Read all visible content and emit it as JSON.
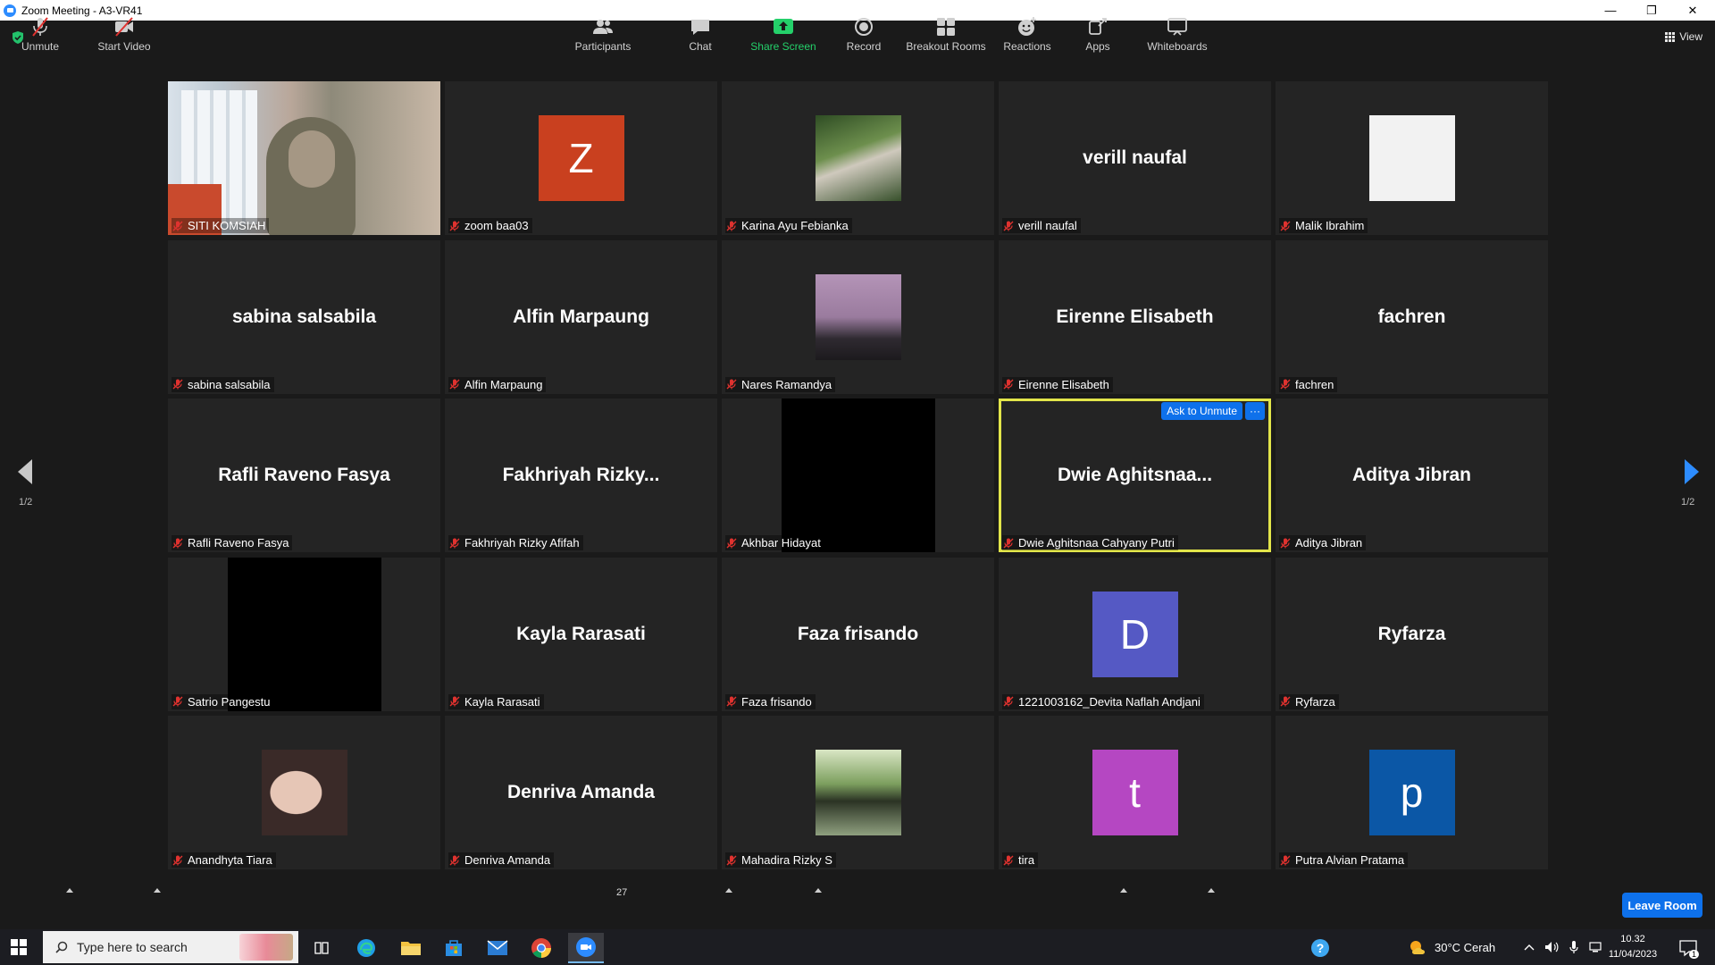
{
  "window": {
    "title": "Zoom Meeting - A3-VR41",
    "minimize": "—",
    "maximize": "❐",
    "close": "✕"
  },
  "view_label": "View",
  "participants": [
    {
      "name": "SITI KOMSIAH",
      "display": "",
      "kind": "photo-woman"
    },
    {
      "name": "zoom baa03",
      "display": "Z",
      "kind": "avatar",
      "color": "#c9401f"
    },
    {
      "name": "Karina Ayu Febianka",
      "display": "",
      "kind": "thumb-karina"
    },
    {
      "name": "verill naufal",
      "display": "verill naufal",
      "kind": "text"
    },
    {
      "name": "Malik Ibrahim",
      "display": "",
      "kind": "thumb-white"
    },
    {
      "name": "sabina salsabila",
      "display": "sabina salsabila",
      "kind": "text"
    },
    {
      "name": "Alfin Marpaung",
      "display": "Alfin Marpaung",
      "kind": "text"
    },
    {
      "name": "Nares Ramandya",
      "display": "",
      "kind": "thumb-nares"
    },
    {
      "name": "Eirenne Elisabeth",
      "display": "Eirenne Elisabeth",
      "kind": "text"
    },
    {
      "name": "fachren",
      "display": "fachren",
      "kind": "text"
    },
    {
      "name": "Rafli Raveno Fasya",
      "display": "Rafli Raveno Fasya",
      "kind": "text"
    },
    {
      "name": "Fakhriyah Rizky Afifah",
      "display": "Fakhriyah  Rizky...",
      "kind": "text"
    },
    {
      "name": "Akhbar Hidayat",
      "display": "",
      "kind": "black"
    },
    {
      "name": "Dwie Aghitsnaa Cahyany Putri",
      "display": "Dwie  Aghitsnaa...",
      "kind": "text",
      "active": true
    },
    {
      "name": "Aditya Jibran",
      "display": "Aditya Jibran",
      "kind": "text"
    },
    {
      "name": "Satrio Pangestu",
      "display": "",
      "kind": "black"
    },
    {
      "name": "Kayla Rarasati",
      "display": "Kayla Rarasati",
      "kind": "text"
    },
    {
      "name": "Faza frisando",
      "display": "Faza frisando",
      "kind": "text"
    },
    {
      "name": "1221003162_Devita Naflah Andjani",
      "display": "D",
      "kind": "avatar",
      "color": "#5559c4"
    },
    {
      "name": "Ryfarza",
      "display": "Ryfarza",
      "kind": "text"
    },
    {
      "name": "Anandhyta Tiara",
      "display": "",
      "kind": "thumb-anan"
    },
    {
      "name": "Denriva Amanda",
      "display": "Denriva Amanda",
      "kind": "text"
    },
    {
      "name": "Mahadira Rizky S",
      "display": "",
      "kind": "thumb-maha"
    },
    {
      "name": "tira",
      "display": "t",
      "kind": "avatar",
      "color": "#b547c2"
    },
    {
      "name": "Putra Alvian Pratama",
      "display": "p",
      "kind": "avatar",
      "color": "#0b57a6"
    }
  ],
  "hover_controls": {
    "ask_to_unmute": "Ask to Unmute",
    "more": "···"
  },
  "pagination": {
    "left": "1/2",
    "right": "1/2"
  },
  "toolbar": {
    "unmute": "Unmute",
    "start_video": "Start Video",
    "participants": "Participants",
    "participant_count": "27",
    "chat": "Chat",
    "share_screen": "Share Screen",
    "record": "Record",
    "breakout_rooms": "Breakout Rooms",
    "reactions": "Reactions",
    "apps": "Apps",
    "whiteboards": "Whiteboards",
    "leave": "Leave Room"
  },
  "taskbar": {
    "search_placeholder": "Type here to search",
    "weather": "30°C  Cerah",
    "time": "10.32",
    "date": "11/04/2023",
    "notifications": "1"
  },
  "colors": {
    "accent": "#0e71eb",
    "active_border": "#e2e54a",
    "share_green": "#24d06a",
    "muted_red": "#e0322f"
  }
}
